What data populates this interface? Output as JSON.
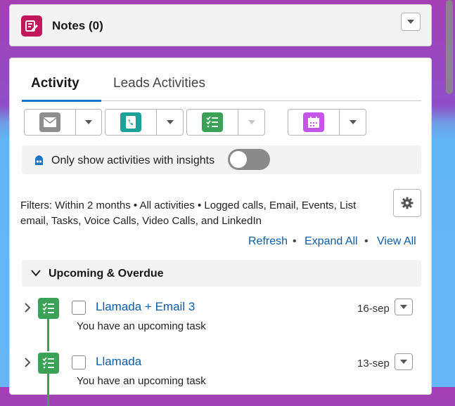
{
  "notes": {
    "title": "Notes (0)"
  },
  "tabs": [
    {
      "label": "Activity"
    },
    {
      "label": "Leads Activities"
    }
  ],
  "actions": [
    {
      "icon": "email-icon",
      "color": "#8e8e8e"
    },
    {
      "icon": "phone-icon",
      "color": "#1ca29a"
    },
    {
      "icon": "task-icon",
      "color": "#3aa157"
    },
    {
      "icon": "event-icon",
      "color": "#c455e8"
    }
  ],
  "insights": {
    "label": "Only show activities with insights"
  },
  "filters": {
    "text": "Filters: Within 2 months • All activities • Logged calls, Email, Events, List email, Tasks, Voice Calls, Video Calls, and LinkedIn"
  },
  "links": {
    "refresh": "Refresh",
    "expand": "Expand All",
    "view": "View All",
    "separator": "•"
  },
  "section": {
    "title": "Upcoming & Overdue"
  },
  "tasks": [
    {
      "title": "Llamada + Email 3",
      "date": "16-sep",
      "subtitle": "You have an upcoming task"
    },
    {
      "title": "Llamada",
      "date": "13-sep",
      "subtitle": "You have an upcoming task"
    }
  ],
  "colors": {
    "accent": "#1b74c8",
    "link": "#0b5cab",
    "task": "#3aa157",
    "notes": "#c2185b"
  }
}
